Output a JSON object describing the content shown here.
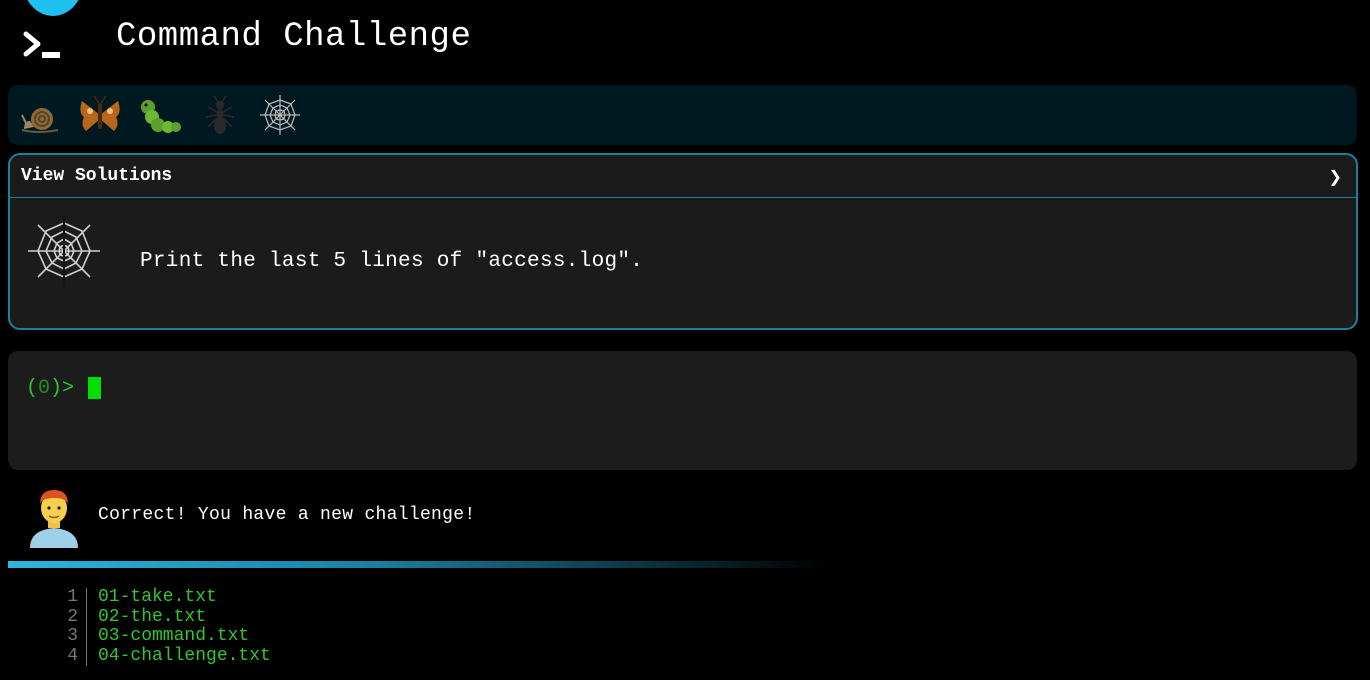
{
  "app": {
    "title": "Command Challenge"
  },
  "levels": [
    {
      "name": "snail"
    },
    {
      "name": "moth"
    },
    {
      "name": "caterpillar"
    },
    {
      "name": "ant"
    },
    {
      "name": "spider-web"
    }
  ],
  "challenge": {
    "view_solutions_label": "View Solutions",
    "chevron": "❯",
    "text": "Print the last 5 lines of \"access.log\"."
  },
  "terminal": {
    "prompt_open": "(",
    "prompt_count": "0",
    "prompt_close": ")>"
  },
  "feedback": {
    "message": "Correct! You have a new challenge!"
  },
  "files": [
    {
      "num": "1",
      "name": "01-take.txt"
    },
    {
      "num": "2",
      "name": "02-the.txt"
    },
    {
      "num": "3",
      "name": "03-command.txt"
    },
    {
      "num": "4",
      "name": "04-challenge.txt"
    }
  ],
  "colors": {
    "accent": "#1ec0f0",
    "panel_border": "#1d7f9a",
    "prompt_green": "#2fc72f",
    "cursor_green": "#00e000"
  }
}
